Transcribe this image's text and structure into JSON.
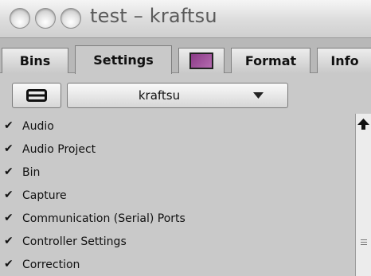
{
  "window": {
    "title": "test – kraftsu",
    "buttons": [
      "close-button",
      "minimize-button",
      "zoom-button"
    ]
  },
  "tabs": [
    {
      "label": "Bins",
      "active": false
    },
    {
      "label": "Settings",
      "active": true
    },
    {
      "label": "",
      "icon": "color-swatch-icon",
      "color": "#9b4f97",
      "active": false
    },
    {
      "label": "Format",
      "active": false
    },
    {
      "label": "Info",
      "active": false
    }
  ],
  "toolbar": {
    "view_icon": "list-view-icon",
    "popup_value": "kraftsu",
    "popup_icon": "chevron-down-icon"
  },
  "settings": {
    "items": [
      {
        "label": "Audio",
        "checked": true
      },
      {
        "label": "Audio Project",
        "checked": true
      },
      {
        "label": "Bin",
        "checked": true
      },
      {
        "label": "Capture",
        "checked": true
      },
      {
        "label": "Communication (Serial) Ports",
        "checked": true
      },
      {
        "label": "Controller Settings",
        "checked": true
      },
      {
        "label": "Correction",
        "checked": true
      }
    ],
    "check_glyph": "✔"
  },
  "scrollbar": {
    "up_icon": "scroll-up-arrow-icon",
    "thumb_icon": "scroll-grip-icon"
  },
  "colors": {
    "panel": "#c9c9c9",
    "swatch": "#9b4f97"
  }
}
